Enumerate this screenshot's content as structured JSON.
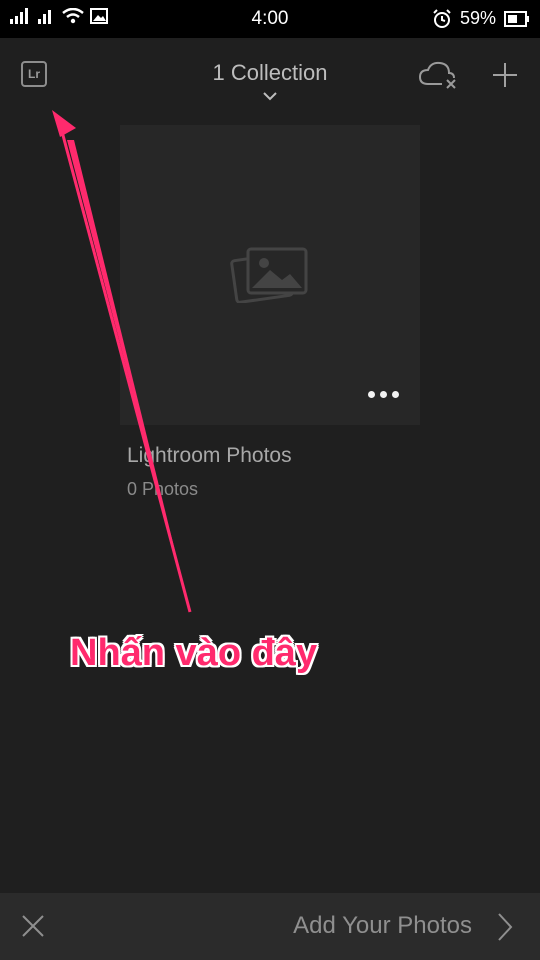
{
  "status_bar": {
    "time": "4:00",
    "battery_percent": "59%",
    "icons": [
      "signal-icon",
      "signal-icon",
      "wifi-icon",
      "image-icon",
      "alarm-icon",
      "battery-icon"
    ]
  },
  "header": {
    "logo_text": "Lr",
    "title": "1 Collection",
    "icons": {
      "cloud": "cloud-off-icon",
      "add": "plus-icon",
      "dropdown": "chevron-down-icon"
    }
  },
  "collection": {
    "title": "Lightroom Photos",
    "count": "0 Photos"
  },
  "annotation": {
    "text": "Nhấn vào đây",
    "color": "#ff2a6d"
  },
  "bottom_bar": {
    "action_label": "Add Your Photos"
  }
}
